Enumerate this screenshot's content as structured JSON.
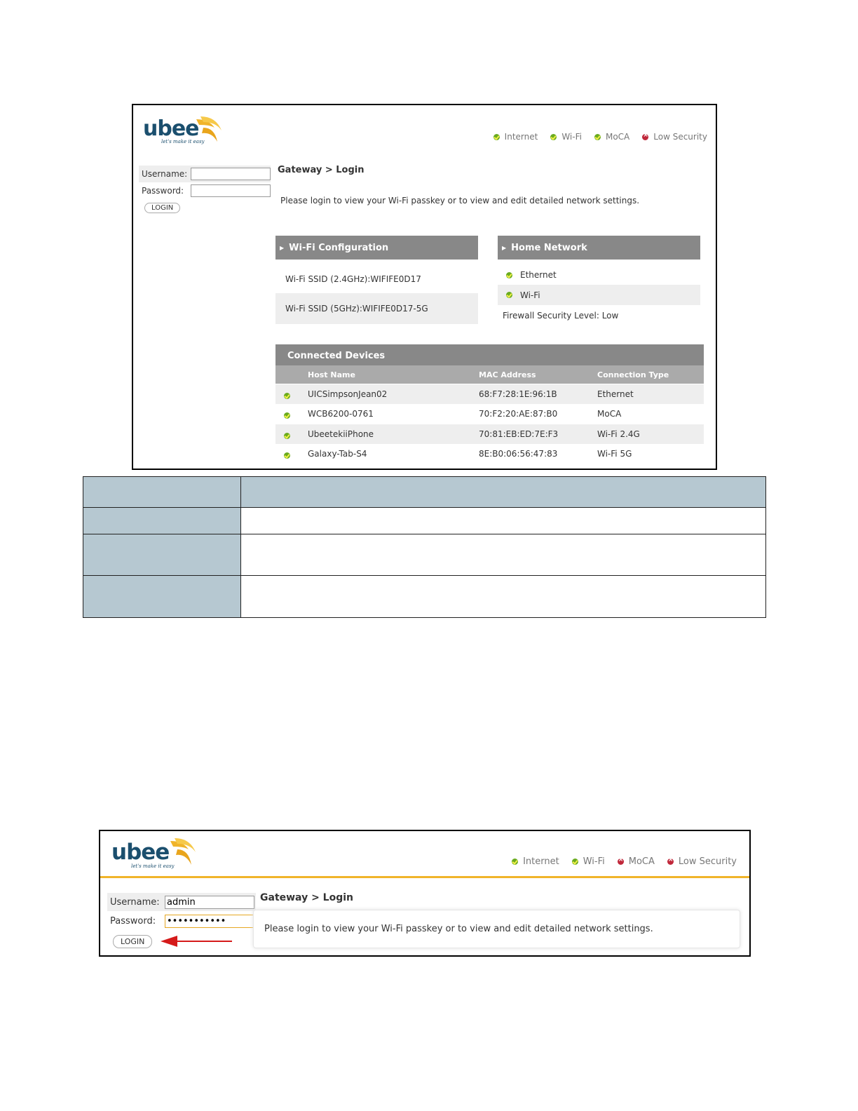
{
  "shot1": {
    "logo": {
      "word": "ubee",
      "tagline": "let's make it easy"
    },
    "status": [
      {
        "label": "Internet",
        "state": "ok"
      },
      {
        "label": "Wi-Fi",
        "state": "ok"
      },
      {
        "label": "MoCA",
        "state": "ok"
      },
      {
        "label": "Low Security",
        "state": "err"
      }
    ],
    "login": {
      "username_label": "Username:",
      "password_label": "Password:",
      "username_value": "",
      "password_value": "",
      "button": "LOGIN"
    },
    "breadcrumb": "Gateway > Login",
    "intro": "Please login to view your Wi-Fi passkey or to view and edit detailed network settings.",
    "wifi_config": {
      "title": "Wi-Fi Configuration",
      "rows": [
        "Wi-Fi SSID (2.4GHz):WIFIFE0D17",
        "Wi-Fi SSID (5GHz):WIFIFE0D17-5G"
      ]
    },
    "home_network": {
      "title": "Home Network",
      "items": [
        {
          "label": "Ethernet",
          "state": "ok"
        },
        {
          "label": "Wi-Fi",
          "state": "ok"
        }
      ],
      "firewall": "Firewall Security Level: Low"
    },
    "connected_devices": {
      "title": "Connected Devices",
      "columns": [
        "Host Name",
        "MAC Address",
        "Connection Type"
      ],
      "rows": [
        {
          "host": "UICSimpsonJean02",
          "mac": "68:F7:28:1E:96:1B",
          "type": "Ethernet"
        },
        {
          "host": "WCB6200-0761",
          "mac": "70:F2:20:AE:87:B0",
          "type": "MoCA"
        },
        {
          "host": "UbeetekiiPhone",
          "mac": "70:81:EB:ED:7E:F3",
          "type": "Wi-Fi 2.4G"
        },
        {
          "host": "Galaxy-Tab-S4",
          "mac": "8E:B0:06:56:47:83",
          "type": "Wi-Fi 5G"
        }
      ]
    }
  },
  "shot2": {
    "logo": {
      "word": "ubee",
      "tagline": "let's make it easy"
    },
    "status": [
      {
        "label": "Internet",
        "state": "ok"
      },
      {
        "label": "Wi-Fi",
        "state": "ok"
      },
      {
        "label": "MoCA",
        "state": "err"
      },
      {
        "label": "Low Security",
        "state": "err"
      }
    ],
    "login": {
      "username_label": "Username:",
      "password_label": "Password:",
      "username_value": "admin",
      "password_value": "•••••••••••",
      "button": "LOGIN"
    },
    "breadcrumb": "Gateway > Login",
    "intro": "Please login to view your Wi-Fi passkey or to view and edit detailed network settings."
  },
  "colors": {
    "brand_navy": "#1b4f6e",
    "brand_gold": "#f0b42a",
    "ok_green": "#6aab1f",
    "err_red": "#c0273a",
    "panel_gray": "#888888",
    "table_blue_gray": "#b6c8d1",
    "arrow_red": "#d51a1a"
  }
}
